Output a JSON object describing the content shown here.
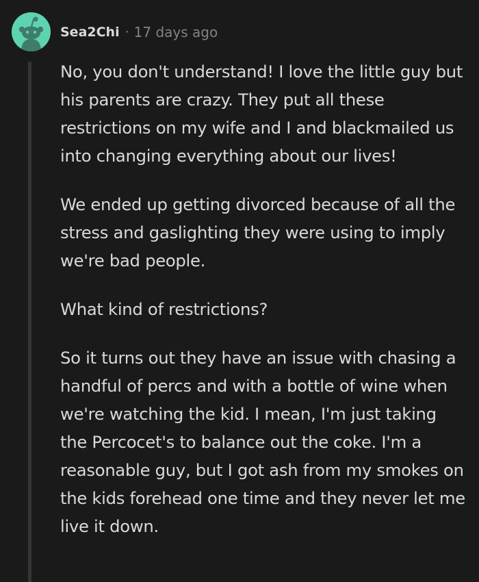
{
  "comment": {
    "username": "Sea2Chi",
    "separator": "·",
    "timestamp": "17 days ago",
    "avatar_icon": "reddit-snoo-icon",
    "avatar_color": "#5ed3b2",
    "paragraphs": [
      "No, you don't understand! I love the little guy but his parents are crazy. They put all these restrictions on my wife and I and blackmailed us into changing everything about our lives!",
      "We ended up getting divorced because of all the stress and gaslighting they were using to imply we're bad people.",
      "What kind of restrictions?",
      "So it turns out they have an issue with chasing a handful of percs and with a bottle of wine when we're watching the kid. I mean, I'm just taking the Percocet's to balance out the coke. I'm a reasonable guy, but I got ash from my smokes on the kids forehead one time and they never let me live it down."
    ]
  },
  "colors": {
    "background": "#1a1a1b",
    "text": "#d7dadc",
    "meta_text": "#818384",
    "thread_line": "#343536"
  }
}
